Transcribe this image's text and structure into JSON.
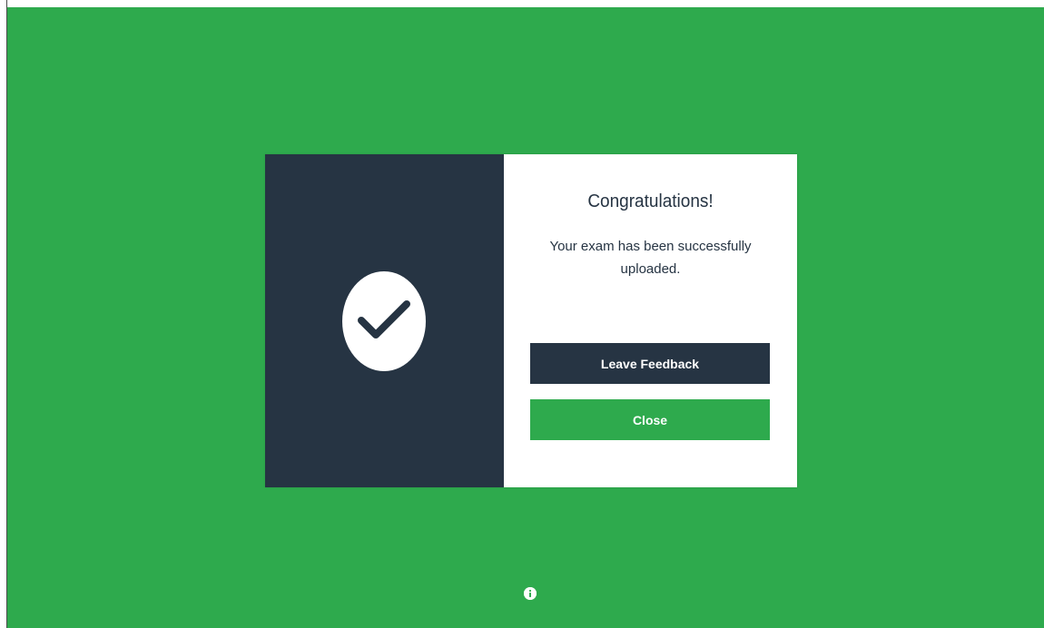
{
  "dialog": {
    "title": "Congratulations!",
    "message": "Your exam has been successfully uploaded.",
    "status_icon": "checkmark-circle-icon",
    "buttons": {
      "leave_feedback_label": "Leave Feedback",
      "close_label": "Close"
    }
  },
  "footer": {
    "info_icon": "info-icon"
  },
  "colors": {
    "background_green": "#2eaa4d",
    "dark_navy": "#263443",
    "white": "#ffffff"
  }
}
